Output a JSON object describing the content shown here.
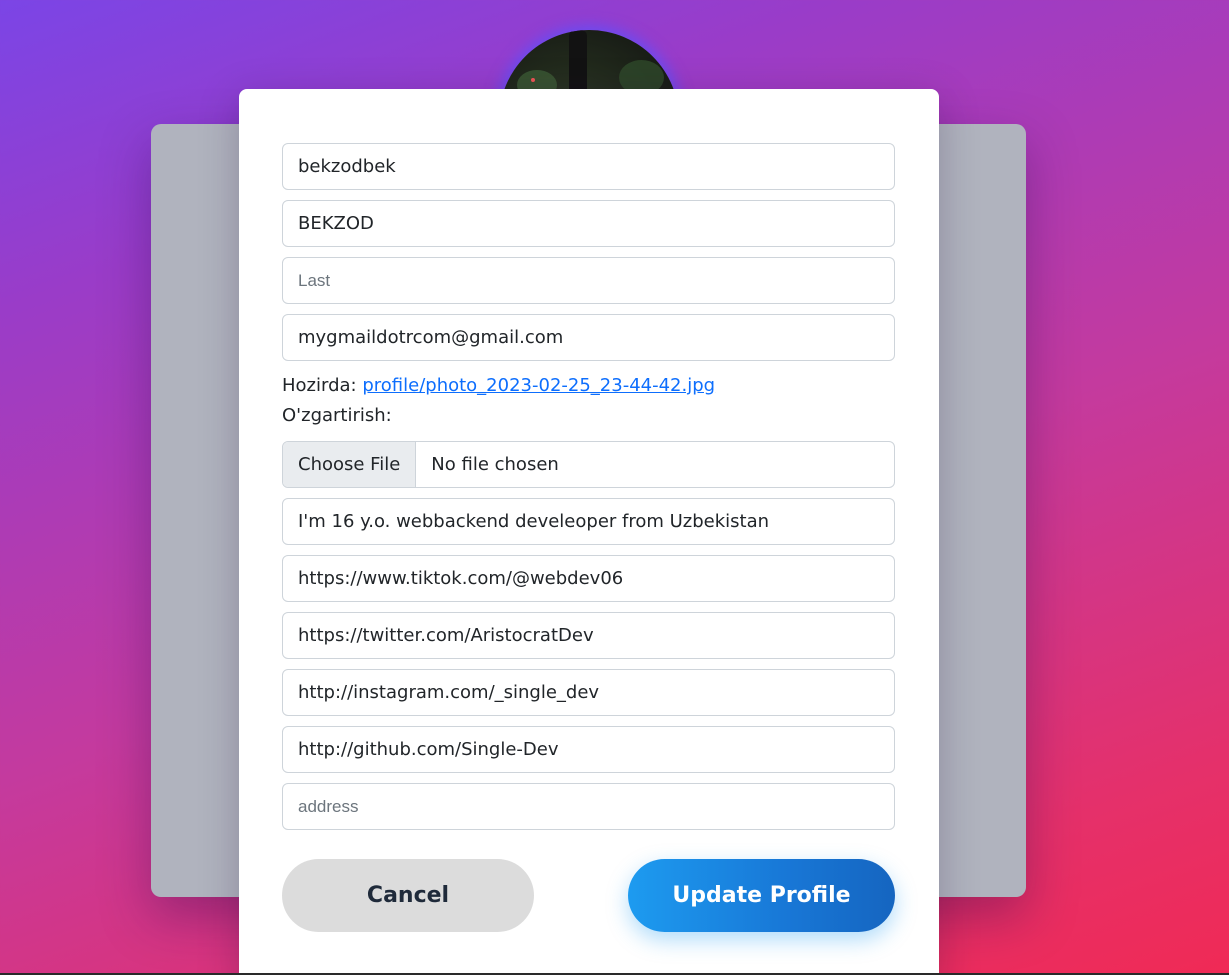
{
  "form": {
    "username": {
      "value": "bekzodbek",
      "placeholder": ""
    },
    "first_name": {
      "value": "BEKZOD",
      "placeholder": ""
    },
    "last_name": {
      "value": "",
      "placeholder": "Last"
    },
    "email": {
      "value": "mygmaildotrcom@gmail.com",
      "placeholder": ""
    },
    "photo": {
      "current_label": "Hozirda:",
      "current_link": "profile/photo_2023-02-25_23-44-42.jpg",
      "change_label": "O'zgartirish:",
      "choose_button": "Choose File",
      "status": "No file chosen"
    },
    "bio": {
      "value": "I'm 16 y.o. webbackend develeoper from Uzbekistan",
      "placeholder": ""
    },
    "tiktok": {
      "value": "https://www.tiktok.com/@webdev06",
      "placeholder": ""
    },
    "twitter": {
      "value": "https://twitter.com/AristocratDev",
      "placeholder": ""
    },
    "instagram": {
      "value": "http://instagram.com/_single_dev",
      "placeholder": ""
    },
    "github": {
      "value": "http://github.com/Single-Dev",
      "placeholder": ""
    },
    "address": {
      "value": "",
      "placeholder": "address"
    }
  },
  "actions": {
    "cancel_label": "Cancel",
    "update_label": "Update Profile"
  },
  "colors": {
    "accent": "#1d9bf0",
    "link": "#0d6efd",
    "background_start": "#7b45e6",
    "background_end": "#f02a55"
  }
}
